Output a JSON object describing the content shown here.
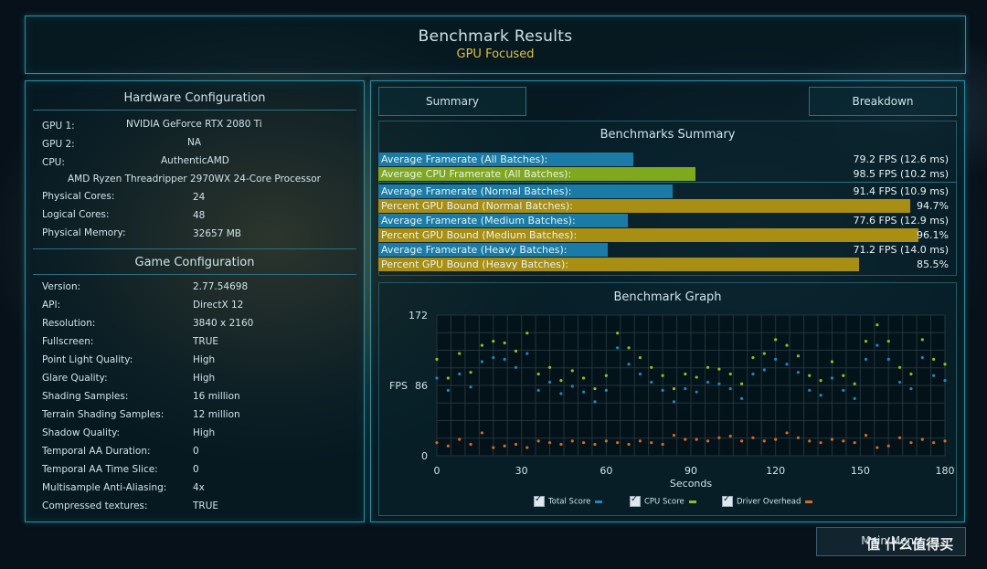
{
  "header": {
    "title": "Benchmark Results",
    "subtitle": "GPU Focused"
  },
  "hardware": {
    "title": "Hardware Configuration",
    "gpu1_label": "GPU 1:",
    "gpu1_value": "NVIDIA GeForce RTX 2080 Ti",
    "gpu2_label": "GPU 2:",
    "gpu2_value": "NA",
    "cpu_label": "CPU:",
    "cpu_value": "AuthenticAMD",
    "cpu_model": "AMD Ryzen Threadripper 2970WX 24-Core Processor",
    "phys_cores_label": "Physical Cores:",
    "phys_cores_value": "24",
    "log_cores_label": "Logical Cores:",
    "log_cores_value": "48",
    "mem_label": "Physical Memory:",
    "mem_value": "32657  MB"
  },
  "game": {
    "title": "Game Configuration",
    "rows": [
      {
        "label": "Version:",
        "value": "2.77.54698"
      },
      {
        "label": "API:",
        "value": "DirectX 12"
      },
      {
        "label": "Resolution:",
        "value": "3840 x 2160"
      },
      {
        "label": "Fullscreen:",
        "value": "TRUE"
      },
      {
        "label": "Point Light Quality:",
        "value": "High"
      },
      {
        "label": "Glare Quality:",
        "value": "High"
      },
      {
        "label": "Shading Samples:",
        "value": "16 million"
      },
      {
        "label": "Terrain Shading Samples:",
        "value": "12 million"
      },
      {
        "label": "Shadow Quality:",
        "value": "High"
      },
      {
        "label": "Temporal AA Duration:",
        "value": "0"
      },
      {
        "label": "Temporal AA Time Slice:",
        "value": "0"
      },
      {
        "label": "Multisample Anti-Aliasing:",
        "value": "4x"
      },
      {
        "label": "Compressed textures:",
        "value": "TRUE"
      }
    ]
  },
  "tabs": {
    "summary": "Summary",
    "breakdown": "Breakdown"
  },
  "summary": {
    "title": "Benchmarks Summary",
    "max_fps": 172,
    "rows": [
      {
        "label": "Average Framerate (All Batches):",
        "value": "79.2 FPS (12.6 ms)",
        "fps": 79.2,
        "color": "#1a7ba6"
      },
      {
        "label": "Average CPU Framerate (All Batches):",
        "value": "98.5 FPS (10.2 ms)",
        "fps": 98.5,
        "color": "#7fa81c"
      },
      {
        "label": "Average Framerate (Normal Batches):",
        "value": "91.4 FPS (10.9 ms)",
        "fps": 91.4,
        "color": "#1a7ba6"
      },
      {
        "label": "Percent GPU Bound (Normal Batches):",
        "value": "94.7%",
        "percent": 94.7,
        "color": "#a88e12"
      },
      {
        "label": "Average Framerate (Medium Batches):",
        "value": "77.6 FPS (12.9 ms)",
        "fps": 77.6,
        "color": "#1a7ba6"
      },
      {
        "label": "Percent GPU Bound (Medium Batches):",
        "value": "96.1%",
        "percent": 96.1,
        "color": "#a88e12"
      },
      {
        "label": "Average Framerate (Heavy Batches):",
        "value": "71.2 FPS (14.0 ms)",
        "fps": 71.2,
        "color": "#1a7ba6"
      },
      {
        "label": "Percent GPU Bound (Heavy Batches):",
        "value": "85.5%",
        "percent": 85.5,
        "color": "#a88e12"
      }
    ]
  },
  "graph": {
    "title": "Benchmark Graph",
    "ylabel": "FPS",
    "xlabel": "Seconds"
  },
  "chart_data": {
    "type": "scatter",
    "title": "Benchmark Graph",
    "xlabel": "Seconds",
    "ylabel": "FPS",
    "xlim": [
      0,
      180
    ],
    "ylim": [
      0,
      172
    ],
    "x_ticks": [
      0,
      30,
      60,
      90,
      120,
      150,
      180
    ],
    "y_ticks": [
      0,
      86,
      172
    ],
    "grid": true,
    "legend_placement": "bottom",
    "series": [
      {
        "name": "Total Score",
        "color": "#1f87c0",
        "x": [
          0,
          4,
          8,
          12,
          16,
          20,
          24,
          28,
          32,
          36,
          40,
          44,
          48,
          52,
          56,
          60,
          64,
          68,
          72,
          76,
          80,
          84,
          88,
          92,
          96,
          100,
          104,
          108,
          112,
          116,
          120,
          124,
          128,
          132,
          136,
          140,
          144,
          148,
          152,
          156,
          160,
          164,
          168,
          172,
          176,
          180
        ],
        "y": [
          95,
          80,
          100,
          84,
          115,
          120,
          118,
          108,
          125,
          80,
          90,
          76,
          85,
          78,
          66,
          80,
          132,
          112,
          100,
          90,
          80,
          66,
          82,
          78,
          90,
          88,
          82,
          70,
          100,
          105,
          118,
          112,
          102,
          80,
          74,
          95,
          80,
          70,
          118,
          135,
          118,
          90,
          82,
          120,
          98,
          92
        ]
      },
      {
        "name": "CPU Score",
        "color": "#8cc020",
        "x": [
          0,
          4,
          8,
          12,
          16,
          20,
          24,
          28,
          32,
          36,
          40,
          44,
          48,
          52,
          56,
          60,
          64,
          68,
          72,
          76,
          80,
          84,
          88,
          92,
          96,
          100,
          104,
          108,
          112,
          116,
          120,
          124,
          128,
          132,
          136,
          140,
          144,
          148,
          152,
          156,
          160,
          164,
          168,
          172,
          176,
          180
        ],
        "y": [
          118,
          95,
          125,
          102,
          135,
          140,
          138,
          128,
          150,
          100,
          108,
          92,
          104,
          95,
          82,
          98,
          150,
          132,
          120,
          108,
          98,
          82,
          100,
          96,
          108,
          106,
          100,
          88,
          120,
          125,
          142,
          135,
          122,
          98,
          92,
          115,
          98,
          88,
          140,
          160,
          140,
          108,
          100,
          142,
          118,
          112
        ]
      },
      {
        "name": "Driver Overhead",
        "color": "#d86a18",
        "x": [
          0,
          4,
          8,
          12,
          16,
          20,
          24,
          28,
          32,
          36,
          40,
          44,
          48,
          52,
          56,
          60,
          64,
          68,
          72,
          76,
          80,
          84,
          88,
          92,
          96,
          100,
          104,
          108,
          112,
          116,
          120,
          124,
          128,
          132,
          136,
          140,
          144,
          148,
          152,
          156,
          160,
          164,
          168,
          172,
          176,
          180
        ],
        "y": [
          16,
          12,
          20,
          14,
          28,
          10,
          12,
          14,
          10,
          18,
          16,
          14,
          18,
          16,
          14,
          18,
          16,
          14,
          18,
          16,
          14,
          25,
          20,
          20,
          18,
          22,
          24,
          18,
          22,
          18,
          20,
          28,
          22,
          18,
          16,
          20,
          18,
          16,
          25,
          10,
          12,
          22,
          16,
          20,
          16,
          18
        ]
      }
    ]
  },
  "legend": {
    "total": "Total Score",
    "cpu": "CPU Score",
    "driver": "Driver Overhead"
  },
  "footer": {
    "main_menu": "Main Menu",
    "watermark": "值 什么值得买"
  }
}
